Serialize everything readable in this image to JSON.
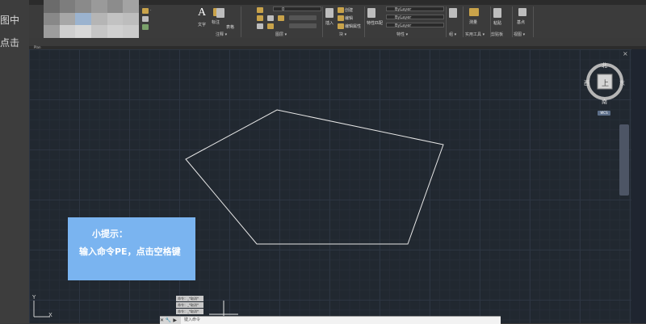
{
  "left_margin": {
    "line1": "图中",
    "line2": "点击"
  },
  "ribbon": {
    "top_tabs": [
      "...",
      "...",
      "..."
    ],
    "text_label": "文字",
    "annotation_label": "标注",
    "table_label": "表格",
    "layer_value": "0",
    "insert_label": "插入",
    "create_label": "创建",
    "edit_label": "编辑",
    "edit_attr_label": "编辑属性",
    "match_label": "特性匹配",
    "bylayer_1": "ByLayer",
    "bylayer_2": "ByLayer",
    "bylayer_3": "ByLayer",
    "measure_label": "测量",
    "paste_label": "粘贴",
    "base_label": "基点",
    "panels": {
      "annotation": "注释 ▾",
      "layers": "图层 ▾",
      "block": "块 ▾",
      "properties": "特性 ▾",
      "groups": "组 ▾",
      "utilities": "实用工具 ▾",
      "clipboard": "剪贴板",
      "view": "视图 ▾"
    }
  },
  "drawing_tab": "Plan",
  "viewcube": {
    "north": "北",
    "south": "南",
    "east": "东",
    "west": "西",
    "top": "上",
    "wcs": "WCS"
  },
  "close_label": "×",
  "tip": {
    "title": "小提示：",
    "body": "输入命令PE，点击空格键"
  },
  "command_history": [
    "命令：_*取消*",
    "命令：_*取消*",
    "命令：_*取消*"
  ],
  "command_prompt": "键入命令",
  "ucs": {
    "x": "X",
    "y": "Y"
  },
  "colors": {
    "canvas": "#212830",
    "tip_bg": "#7ab4f0",
    "polygon_stroke": "#e6e6e6"
  }
}
